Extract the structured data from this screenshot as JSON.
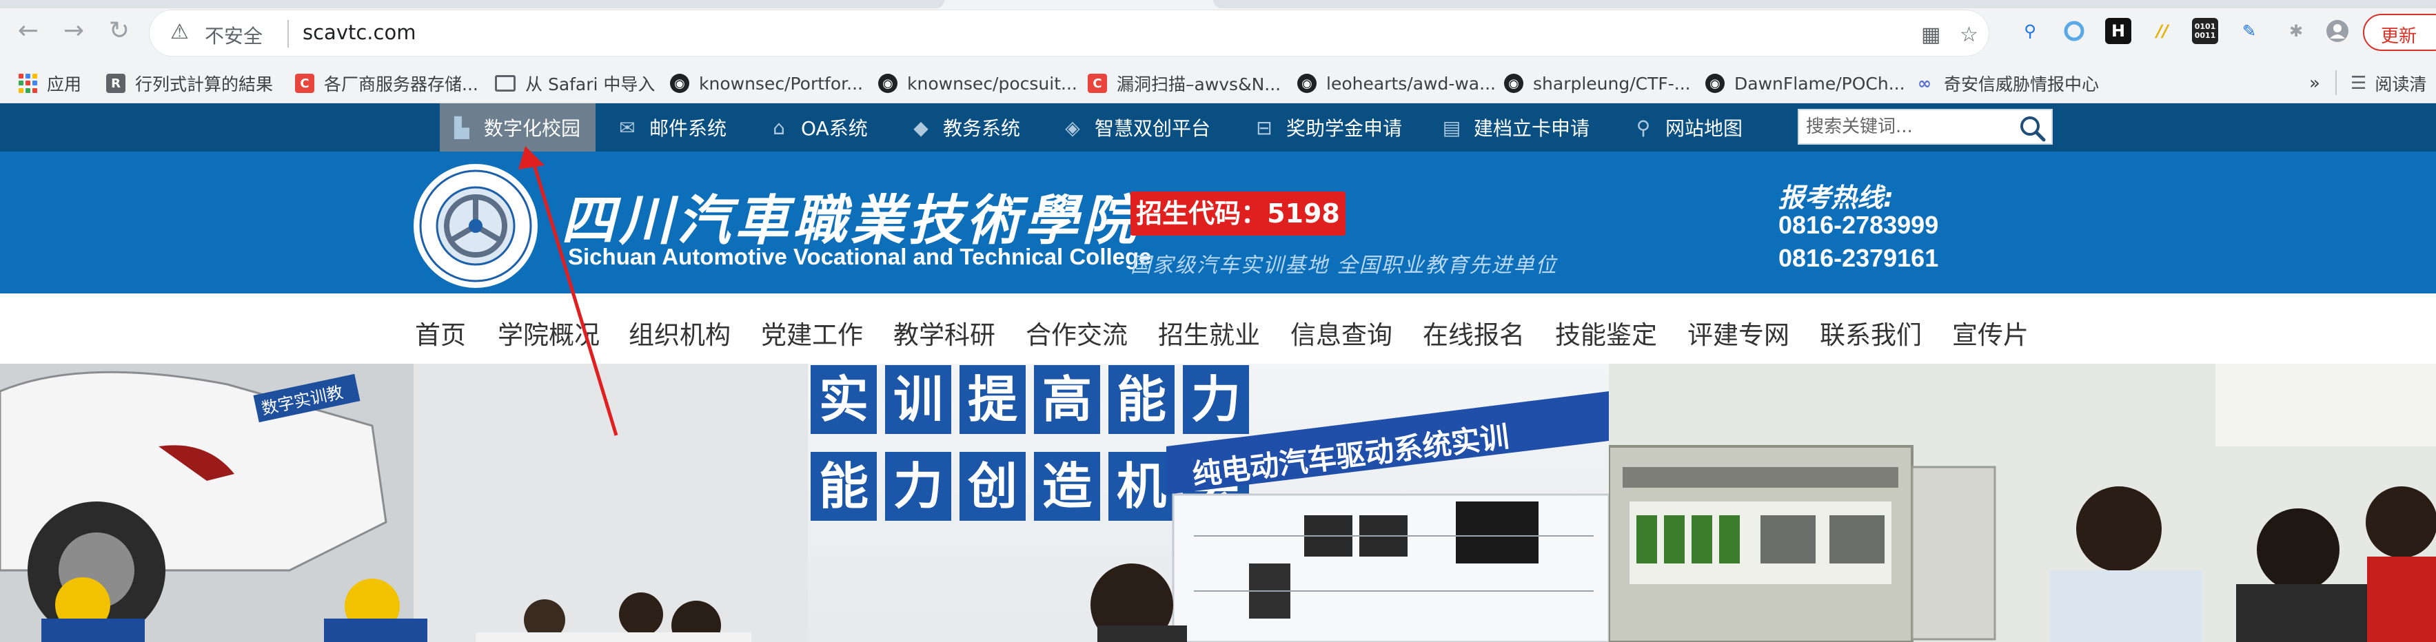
{
  "browser": {
    "address": {
      "security_label": "不安全",
      "url": "scavtc.com"
    },
    "update_label": "更新",
    "reading_list_label": "阅读清",
    "extension_binary_label": "0101 0011",
    "extension_h_label": "H",
    "bookmarks_overflow": "»"
  },
  "bookmarks": [
    {
      "label": "应用",
      "icon": "apps-grid-icon"
    },
    {
      "label": "行列式計算的結果",
      "icon": "r-icon"
    },
    {
      "label": "各厂商服务器存储...",
      "icon": "red-c-icon"
    },
    {
      "label": "从 Safari 中导入",
      "icon": "folder-icon"
    },
    {
      "label": "knownsec/Portfor...",
      "icon": "github-icon"
    },
    {
      "label": "knownsec/pocsuit...",
      "icon": "github-icon"
    },
    {
      "label": "漏洞扫描–awvs&N...",
      "icon": "red-c-icon"
    },
    {
      "label": "leohearts/awd-wa...",
      "icon": "github-icon"
    },
    {
      "label": "sharpleung/CTF-...",
      "icon": "github-icon"
    },
    {
      "label": "DawnFlame/POCh...",
      "icon": "github-icon"
    },
    {
      "label": "奇安信威胁情报中心",
      "icon": "qianxin-icon"
    }
  ],
  "topbar": {
    "items": [
      {
        "label": "数字化校园",
        "icon": "campus-icon"
      },
      {
        "label": "邮件系统",
        "icon": "mail-icon"
      },
      {
        "label": "OA系统",
        "icon": "oa-icon"
      },
      {
        "label": "教务系统",
        "icon": "mortarboard-icon"
      },
      {
        "label": "智慧双创平台",
        "icon": "cube-icon"
      },
      {
        "label": "奖助学金申请",
        "icon": "gift-icon"
      },
      {
        "label": "建档立卡申请",
        "icon": "card-icon"
      },
      {
        "label": "网站地图",
        "icon": "map-pin-icon"
      }
    ],
    "search_placeholder": "搜索关键词..."
  },
  "header": {
    "name_cn": "四川汽車職業技術學院",
    "name_en": "Sichuan Automotive Vocational and Technical College",
    "admission_code": "招生代码：5198",
    "slogan": "国家级汽车实训基地  全国职业教育先进单位",
    "hotline_label": "报考热线:",
    "hotlines": [
      "0816-2783999",
      "0816-2379161"
    ]
  },
  "nav": {
    "items": [
      "首页",
      "学院概况",
      "组织机构",
      "党建工作",
      "教学科研",
      "合作交流",
      "招生就业",
      "信息查询",
      "在线报名",
      "技能鉴定",
      "评建专网",
      "联系我们",
      "宣传片"
    ]
  },
  "hero": {
    "car_sticker": "数字实训教",
    "slogan_chars_row1": [
      "实",
      "训",
      "提",
      "高",
      "能",
      "力"
    ],
    "slogan_chars_row2": [
      "能",
      "力",
      "创",
      "造",
      "机",
      "会"
    ],
    "lab_banner": "纯电动汽车驱动系统实训"
  },
  "colors": {
    "topbar_bg": "#0a4f82",
    "header_bg": "#0d6fba",
    "admission_bg": "#e0201e",
    "annotation_arrow": "#e02020"
  }
}
